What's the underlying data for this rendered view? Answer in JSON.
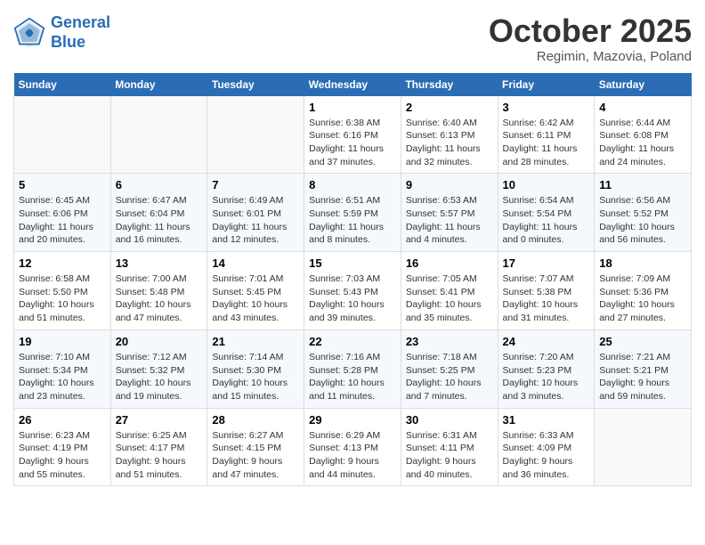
{
  "header": {
    "logo_line1": "General",
    "logo_line2": "Blue",
    "month": "October 2025",
    "location": "Regimin, Mazovia, Poland"
  },
  "days_of_week": [
    "Sunday",
    "Monday",
    "Tuesday",
    "Wednesday",
    "Thursday",
    "Friday",
    "Saturday"
  ],
  "weeks": [
    [
      {
        "day": "",
        "content": ""
      },
      {
        "day": "",
        "content": ""
      },
      {
        "day": "",
        "content": ""
      },
      {
        "day": "1",
        "content": "Sunrise: 6:38 AM\nSunset: 6:16 PM\nDaylight: 11 hours\nand 37 minutes."
      },
      {
        "day": "2",
        "content": "Sunrise: 6:40 AM\nSunset: 6:13 PM\nDaylight: 11 hours\nand 32 minutes."
      },
      {
        "day": "3",
        "content": "Sunrise: 6:42 AM\nSunset: 6:11 PM\nDaylight: 11 hours\nand 28 minutes."
      },
      {
        "day": "4",
        "content": "Sunrise: 6:44 AM\nSunset: 6:08 PM\nDaylight: 11 hours\nand 24 minutes."
      }
    ],
    [
      {
        "day": "5",
        "content": "Sunrise: 6:45 AM\nSunset: 6:06 PM\nDaylight: 11 hours\nand 20 minutes."
      },
      {
        "day": "6",
        "content": "Sunrise: 6:47 AM\nSunset: 6:04 PM\nDaylight: 11 hours\nand 16 minutes."
      },
      {
        "day": "7",
        "content": "Sunrise: 6:49 AM\nSunset: 6:01 PM\nDaylight: 11 hours\nand 12 minutes."
      },
      {
        "day": "8",
        "content": "Sunrise: 6:51 AM\nSunset: 5:59 PM\nDaylight: 11 hours\nand 8 minutes."
      },
      {
        "day": "9",
        "content": "Sunrise: 6:53 AM\nSunset: 5:57 PM\nDaylight: 11 hours\nand 4 minutes."
      },
      {
        "day": "10",
        "content": "Sunrise: 6:54 AM\nSunset: 5:54 PM\nDaylight: 11 hours\nand 0 minutes."
      },
      {
        "day": "11",
        "content": "Sunrise: 6:56 AM\nSunset: 5:52 PM\nDaylight: 10 hours\nand 56 minutes."
      }
    ],
    [
      {
        "day": "12",
        "content": "Sunrise: 6:58 AM\nSunset: 5:50 PM\nDaylight: 10 hours\nand 51 minutes."
      },
      {
        "day": "13",
        "content": "Sunrise: 7:00 AM\nSunset: 5:48 PM\nDaylight: 10 hours\nand 47 minutes."
      },
      {
        "day": "14",
        "content": "Sunrise: 7:01 AM\nSunset: 5:45 PM\nDaylight: 10 hours\nand 43 minutes."
      },
      {
        "day": "15",
        "content": "Sunrise: 7:03 AM\nSunset: 5:43 PM\nDaylight: 10 hours\nand 39 minutes."
      },
      {
        "day": "16",
        "content": "Sunrise: 7:05 AM\nSunset: 5:41 PM\nDaylight: 10 hours\nand 35 minutes."
      },
      {
        "day": "17",
        "content": "Sunrise: 7:07 AM\nSunset: 5:38 PM\nDaylight: 10 hours\nand 31 minutes."
      },
      {
        "day": "18",
        "content": "Sunrise: 7:09 AM\nSunset: 5:36 PM\nDaylight: 10 hours\nand 27 minutes."
      }
    ],
    [
      {
        "day": "19",
        "content": "Sunrise: 7:10 AM\nSunset: 5:34 PM\nDaylight: 10 hours\nand 23 minutes."
      },
      {
        "day": "20",
        "content": "Sunrise: 7:12 AM\nSunset: 5:32 PM\nDaylight: 10 hours\nand 19 minutes."
      },
      {
        "day": "21",
        "content": "Sunrise: 7:14 AM\nSunset: 5:30 PM\nDaylight: 10 hours\nand 15 minutes."
      },
      {
        "day": "22",
        "content": "Sunrise: 7:16 AM\nSunset: 5:28 PM\nDaylight: 10 hours\nand 11 minutes."
      },
      {
        "day": "23",
        "content": "Sunrise: 7:18 AM\nSunset: 5:25 PM\nDaylight: 10 hours\nand 7 minutes."
      },
      {
        "day": "24",
        "content": "Sunrise: 7:20 AM\nSunset: 5:23 PM\nDaylight: 10 hours\nand 3 minutes."
      },
      {
        "day": "25",
        "content": "Sunrise: 7:21 AM\nSunset: 5:21 PM\nDaylight: 9 hours\nand 59 minutes."
      }
    ],
    [
      {
        "day": "26",
        "content": "Sunrise: 6:23 AM\nSunset: 4:19 PM\nDaylight: 9 hours\nand 55 minutes."
      },
      {
        "day": "27",
        "content": "Sunrise: 6:25 AM\nSunset: 4:17 PM\nDaylight: 9 hours\nand 51 minutes."
      },
      {
        "day": "28",
        "content": "Sunrise: 6:27 AM\nSunset: 4:15 PM\nDaylight: 9 hours\nand 47 minutes."
      },
      {
        "day": "29",
        "content": "Sunrise: 6:29 AM\nSunset: 4:13 PM\nDaylight: 9 hours\nand 44 minutes."
      },
      {
        "day": "30",
        "content": "Sunrise: 6:31 AM\nSunset: 4:11 PM\nDaylight: 9 hours\nand 40 minutes."
      },
      {
        "day": "31",
        "content": "Sunrise: 6:33 AM\nSunset: 4:09 PM\nDaylight: 9 hours\nand 36 minutes."
      },
      {
        "day": "",
        "content": ""
      }
    ]
  ]
}
